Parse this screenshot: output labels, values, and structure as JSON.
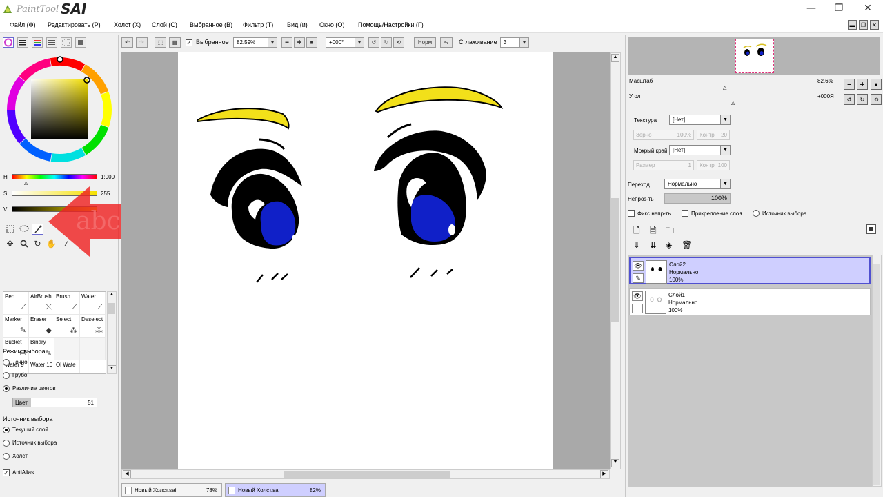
{
  "app": {
    "logo_small": "PaintTool",
    "logo_big": "SAI",
    "minimize": "—",
    "restore": "❐",
    "close": "✕"
  },
  "menu": [
    "Файл (Ф)",
    "Редактировать (Р)",
    "Холст (Х)",
    "Слой (С)",
    "Выбранное (В)",
    "Фильтр (Т)",
    "Вид (и)",
    "Окно (О)",
    "Помощь/Настройки (Г)"
  ],
  "toolbar": {
    "selected_label": "Выбранное",
    "zoom_value": "82.59%",
    "angle_value": "+000°",
    "norm_label": "Норм",
    "smoothing_label": "Сглаживание",
    "smoothing_value": "3"
  },
  "color_panel": {
    "h_label": "H",
    "h_value": "1:000",
    "s_label": "S",
    "s_value": "255",
    "v_label": "V"
  },
  "brushes": [
    {
      "label": "Pen",
      "icon": "pen-icon"
    },
    {
      "label": "AirBrush",
      "icon": "airbrush-icon"
    },
    {
      "label": "Brush",
      "icon": "brush-icon"
    },
    {
      "label": "Water",
      "icon": "water-icon"
    },
    {
      "label": "Marker",
      "icon": "marker-icon"
    },
    {
      "label": "Eraser",
      "icon": "eraser-icon"
    },
    {
      "label": "Select",
      "icon": "select-icon"
    },
    {
      "label": "Deselect",
      "icon": "deselect-icon"
    },
    {
      "label": "Bucket",
      "icon": "bucket-icon"
    },
    {
      "label": "Binary",
      "icon": "binary-icon"
    },
    {
      "label": "Water 9",
      "icon": ""
    },
    {
      "label": "Water 10",
      "icon": ""
    },
    {
      "label": "Ol Wate",
      "icon": ""
    }
  ],
  "select_mode": {
    "title": "Режим выбора",
    "options": [
      "Точно",
      "Грубо",
      "Различие цветов"
    ],
    "selected": 2,
    "color_label": "Цвет",
    "color_value": "51"
  },
  "select_source": {
    "title": "Источник выбора",
    "options": [
      "Текущий слой",
      "Источник выбора",
      "Холст"
    ],
    "selected": 0,
    "antialias_label": "AntiAlias"
  },
  "overlay": {
    "arrow_text": "abc"
  },
  "navigator": {
    "scale_label": "Масштаб",
    "scale_value": "82.6%",
    "angle_label": "Угол",
    "angle_value": "+000Я"
  },
  "brush_props": {
    "texture_label": "Текстура",
    "texture_value": "[Нет]",
    "grain_label": "Зерно",
    "grain_value": "100%",
    "contrast1_label": "Контр",
    "contrast1_value": "20",
    "wet_label": "Мокрый край",
    "wet_value": "[Нет]",
    "size_label": "Размер",
    "size_value": "1",
    "contrast2_label": "Контр",
    "contrast2_value": "100"
  },
  "layer_props": {
    "blend_label": "Переход",
    "blend_value": "Нормально",
    "opacity_label": "Непроз-ть",
    "opacity_value": "100%",
    "fix_opacity_label": "Фикс непр-ть",
    "clip_label": "Прикрепление слоя",
    "source_label": "Источник выбора"
  },
  "layers": [
    {
      "name": "Слой2",
      "mode": "Нормально",
      "opacity": "100%",
      "selected": true
    },
    {
      "name": "Слой1",
      "mode": "Нормально",
      "opacity": "100%",
      "selected": false
    }
  ],
  "tabs": [
    {
      "name": "Новый Холст.sai",
      "zoom": "78%"
    },
    {
      "name": "Новый Холст.sai",
      "zoom": "82%"
    }
  ],
  "colors": {
    "accent": "#cfcfff",
    "eye_blue": "#1020c8",
    "brow_yellow": "#f2e01a",
    "arrow_red": "#ee2222"
  }
}
